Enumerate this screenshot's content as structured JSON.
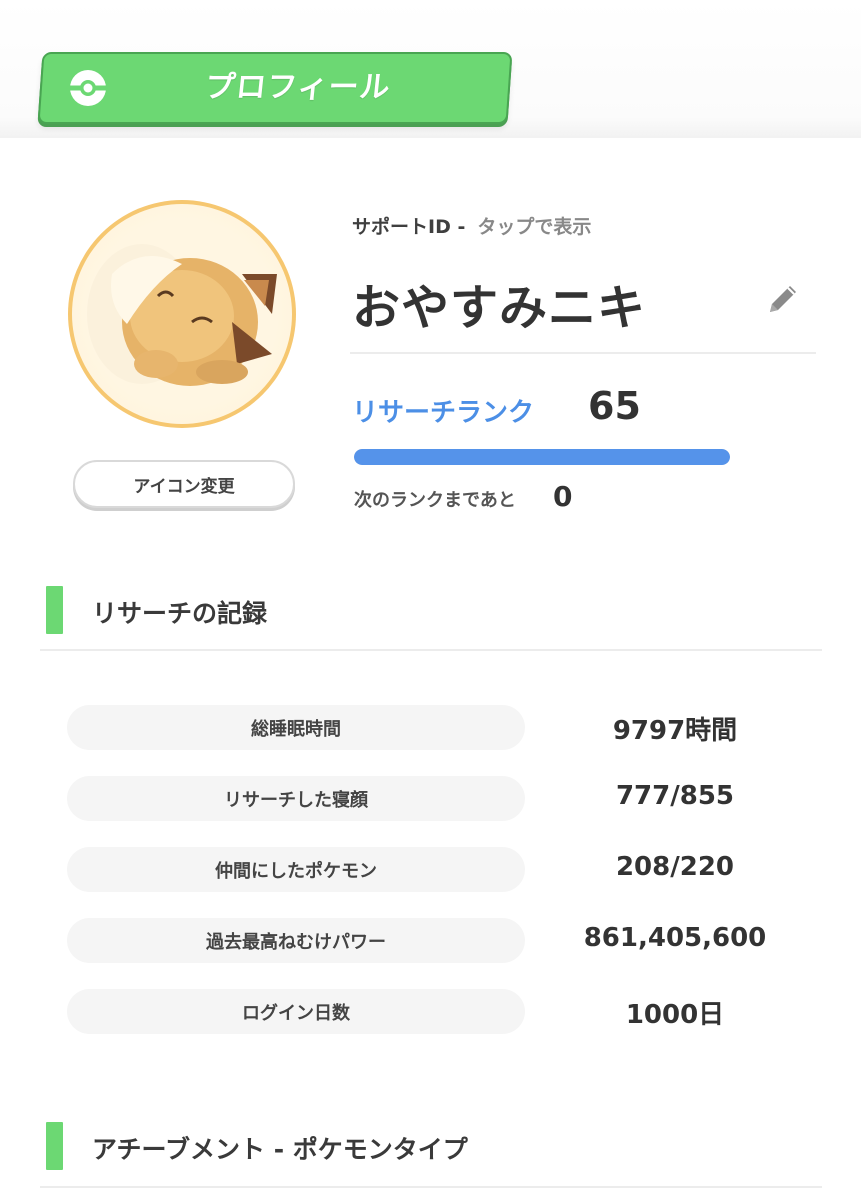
{
  "header": {
    "title": "プロフィール"
  },
  "profile": {
    "support_id_label": "サポートID -",
    "support_id_tap": "タップで表示",
    "name": "おやすみニキ",
    "icon_change_label": "アイコン変更",
    "rank_label": "リサーチランク",
    "rank_value": "65",
    "rank_progress": 1.0,
    "next_rank_label": "次のランクまであと",
    "next_rank_value": "0"
  },
  "research_section": {
    "title": "リサーチの記録",
    "stats": [
      {
        "label": "総睡眠時間",
        "value": "9797時間"
      },
      {
        "label": "リサーチした寝顔",
        "value": "777/855"
      },
      {
        "label": "仲間にしたポケモン",
        "value": "208/220"
      },
      {
        "label": "過去最高ねむけパワー",
        "value": "861,405,600"
      },
      {
        "label": "ログイン日数",
        "value": "1000日"
      }
    ]
  },
  "achievement_section": {
    "title": "アチーブメント - ポケモンタイプ"
  },
  "colors": {
    "accent_green": "#6cd873",
    "rank_blue": "#4c8fe6",
    "avatar_ring": "#f6c770"
  },
  "icons": [
    "pokeball-icon",
    "edit-pencil-icon"
  ]
}
